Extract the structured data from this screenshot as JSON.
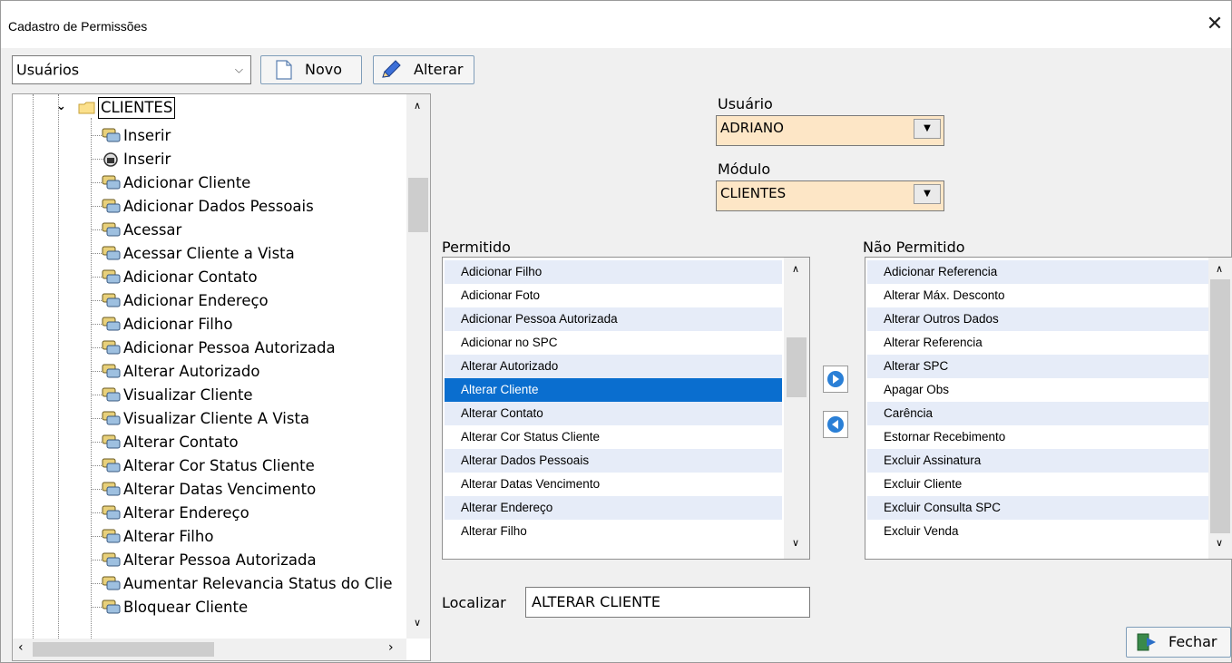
{
  "window": {
    "title": "Cadastro de Permissões",
    "close_icon": "close-icon"
  },
  "toolbar": {
    "type_select": {
      "value": "Usuários"
    },
    "new_label": "Novo",
    "edit_label": "Alterar"
  },
  "tree": {
    "root_label": "CLIENTES",
    "items": [
      "Inserir",
      "Inserir",
      "Adicionar Cliente",
      "Adicionar Dados Pessoais",
      "Acessar",
      "Acessar Cliente a Vista",
      "Adicionar Contato",
      "Adicionar Endereço",
      "Adicionar Filho",
      "Adicionar Pessoa Autorizada",
      "Alterar Autorizado",
      "Visualizar Cliente",
      "Visualizar Cliente A Vista",
      "Alterar Contato",
      "Alterar Cor Status Cliente",
      "Alterar Datas Vencimento",
      "Alterar Endereço",
      "Alterar Filho",
      "Alterar Pessoa Autorizada",
      "Aumentar Relevancia Status do Clie",
      "Bloquear Cliente"
    ]
  },
  "user": {
    "label": "Usuário",
    "value": "ADRIANO"
  },
  "module": {
    "label": "Módulo",
    "value": "CLIENTES"
  },
  "allowed": {
    "label": "Permitido",
    "items": [
      "Adicionar Filho",
      "Adicionar Foto",
      "Adicionar Pessoa Autorizada",
      "Adicionar no SPC",
      "Alterar Autorizado",
      "Alterar Cliente",
      "Alterar Contato",
      "Alterar Cor Status Cliente",
      "Alterar Dados Pessoais",
      "Alterar Datas Vencimento",
      "Alterar Endereço",
      "Alterar Filho"
    ],
    "selected": "Alterar Cliente"
  },
  "denied": {
    "label": "Não Permitido",
    "items": [
      "Adicionar Referencia",
      "Alterar Máx. Desconto",
      "Alterar Outros Dados",
      "Alterar Referencia",
      "Alterar SPC",
      "Apagar Obs",
      "Carência",
      "Estornar Recebimento",
      "Excluir Assinatura",
      "Excluir Cliente",
      "Excluir Consulta SPC",
      "Excluir Venda"
    ]
  },
  "search": {
    "label": "Localizar",
    "value": "ALTERAR CLIENTE"
  },
  "close_button": {
    "label": "Fechar"
  },
  "colors": {
    "accent": "#0a6ecf",
    "combo_bg": "#fde6c6",
    "alt_row": "#e6ecf8"
  }
}
